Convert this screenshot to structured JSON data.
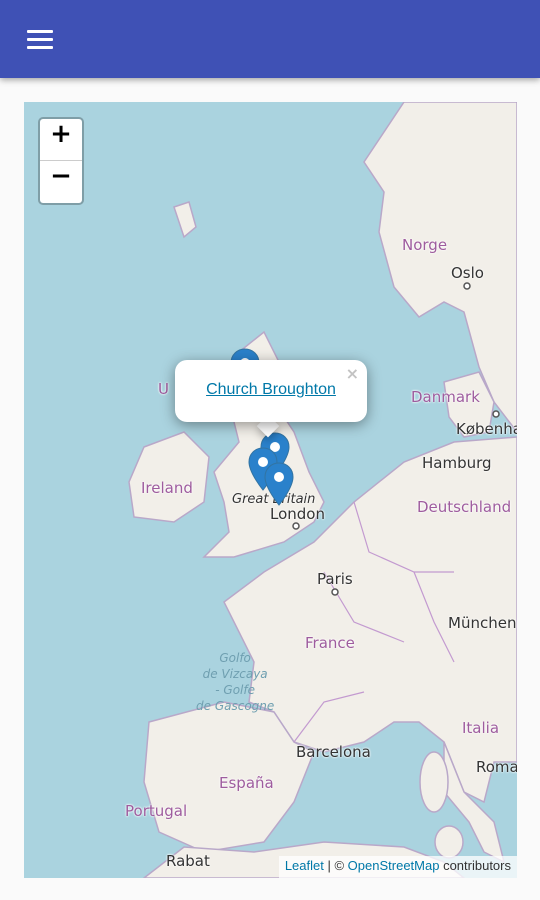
{
  "appbar": {
    "background": "#3f51b5",
    "menu_icon": "hamburger-menu-icon"
  },
  "map": {
    "zoom_in_label": "+",
    "zoom_out_label": "−",
    "labels": {
      "norge": "Norge",
      "oslo": "Oslo",
      "danmark": "Danmark",
      "kobenhavn": "København",
      "hamburg": "Hamburg",
      "deutschland": "Deutschland",
      "ireland": "Ireland",
      "great_britain": "Great Britain",
      "london": "London",
      "paris": "Paris",
      "france": "France",
      "munchen": "München",
      "golfo": "Golfo\nde Vizcaya\n- Golfe\nde Gascogne",
      "italia": "Italia",
      "roma": "Roma",
      "barcelona": "Barcelona",
      "espana": "España",
      "portugal": "Portugal",
      "rabat": "Rabat",
      "uk_partial": "U"
    },
    "popup": {
      "link_text": "Church Broughton",
      "close_label": "×"
    },
    "attribution": {
      "leaflet": "Leaflet",
      "separator": " | © ",
      "osm": "OpenStreetMap",
      "suffix": " contributors"
    },
    "marker_color": "#2a81cb",
    "marker_count": 4
  }
}
